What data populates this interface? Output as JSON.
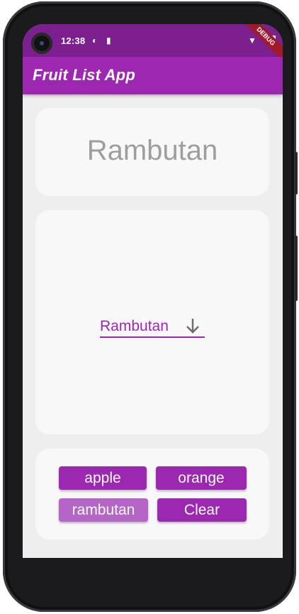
{
  "status_bar": {
    "time": "12:38",
    "icons": [
      "data-saver-icon",
      "sd-card-icon",
      "wifi-icon",
      "battery-icon"
    ],
    "debug_banner": "DEBUG"
  },
  "app_bar": {
    "title": "Fruit List App"
  },
  "display": {
    "selected_fruit": "Rambutan"
  },
  "dropdown": {
    "value": "Rambutan",
    "icon": "arrow-down-icon"
  },
  "buttons": [
    {
      "label": "apple",
      "state": "normal"
    },
    {
      "label": "orange",
      "state": "normal"
    },
    {
      "label": "rambutan",
      "state": "selected"
    },
    {
      "label": "Clear",
      "state": "normal"
    }
  ],
  "colors": {
    "primary": "#9d27b0",
    "status_bar": "#7c1f8f",
    "selected_button": "#b565c8",
    "background": "#eeeeee",
    "card": "#f8f8f8",
    "display_text": "#9e9e9e"
  }
}
